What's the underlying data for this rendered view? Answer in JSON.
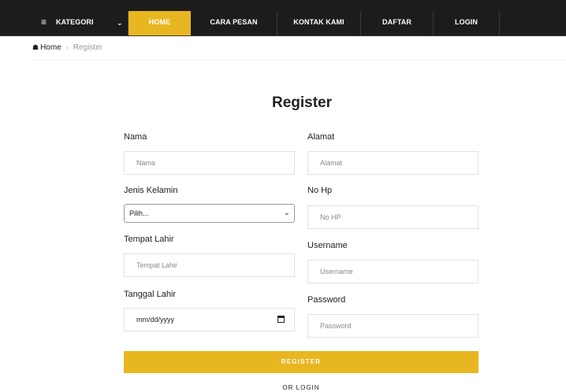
{
  "nav": {
    "category_label": "KATEGORI",
    "items": [
      "HOME",
      "CARA PESAN",
      "KONTAK KAMI",
      "DAFTAR",
      "LOGIN"
    ],
    "active_item": "HOME",
    "accent_color": "#e8b620",
    "bar_color": "#1c1c1c"
  },
  "breadcrumb": {
    "home": "Home",
    "current": "Register"
  },
  "page": {
    "title": "Register"
  },
  "form": {
    "nama": {
      "label": "Nama",
      "placeholder": "Nama"
    },
    "alamat": {
      "label": "Alamat",
      "placeholder": "Alamat"
    },
    "jenis_kelamin": {
      "label": "Jenis Kelamin",
      "selected": "Pilih..."
    },
    "no_hp": {
      "label": "No Hp",
      "placeholder": "No HP"
    },
    "tempat_lahir": {
      "label": "Tempat Lahir",
      "placeholder": "Tempat Lahir"
    },
    "username": {
      "label": "Username",
      "placeholder": "Username"
    },
    "tanggal_lahir": {
      "label": "Tanggal Lahir",
      "placeholder": "mm/dd/yyyy"
    },
    "password": {
      "label": "Password",
      "placeholder": "Password"
    },
    "register_label": "REGISTER",
    "or_login_label": "OR LOGIN"
  }
}
